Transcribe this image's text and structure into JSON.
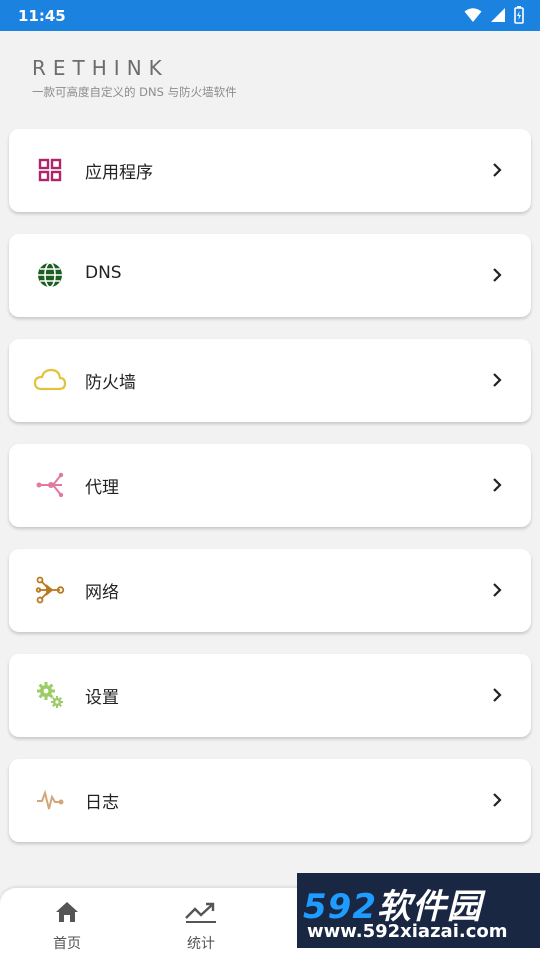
{
  "status_bar": {
    "time": "11:45"
  },
  "header": {
    "brand": "RETHINK",
    "tagline": "一款可高度自定义的 DNS 与防火墙软件"
  },
  "menu": [
    {
      "label": "应用程序",
      "icon": "apps-grid-icon",
      "color": "#b0246a"
    },
    {
      "label": "DNS",
      "icon": "globe-icon",
      "color": "#1b5e20"
    },
    {
      "label": "防火墙",
      "icon": "cloud-icon",
      "color": "#e3c23c"
    },
    {
      "label": "代理",
      "icon": "proxy-icon",
      "color": "#e07aa0"
    },
    {
      "label": "网络",
      "icon": "network-icon",
      "color": "#b97a1e"
    },
    {
      "label": "设置",
      "icon": "gears-icon",
      "color": "#9ccc65"
    },
    {
      "label": "日志",
      "icon": "pulse-icon",
      "color": "#d2a679"
    }
  ],
  "bottom_nav": [
    {
      "label": "首页",
      "icon": "home-icon"
    },
    {
      "label": "统计",
      "icon": "trending-up-icon"
    }
  ],
  "watermark": {
    "brand_number": "592",
    "brand_text": "软件园",
    "url": "www.592xiazai.com"
  }
}
